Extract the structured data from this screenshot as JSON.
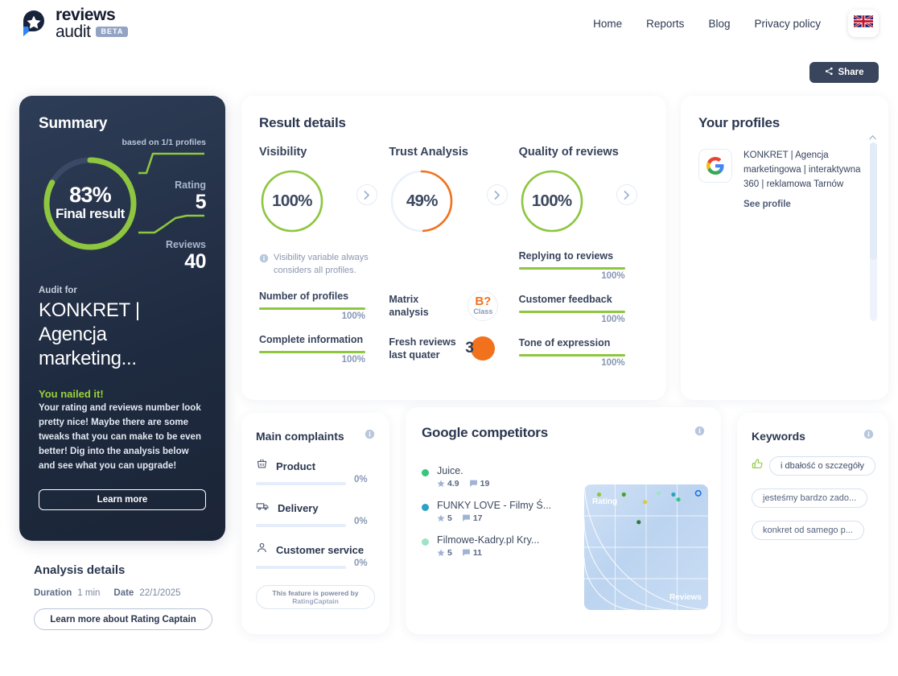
{
  "header": {
    "logo_line1": "reviews",
    "logo_line2": "audit",
    "beta": "BETA",
    "nav": [
      {
        "label": "Home"
      },
      {
        "label": "Reports"
      },
      {
        "label": "Blog"
      },
      {
        "label": "Privacy policy"
      }
    ],
    "flag_icon": "uk-flag-icon"
  },
  "share": {
    "label": "Share",
    "icon": "share-icon"
  },
  "summary": {
    "title": "Summary",
    "based_on": "based on 1/1 profiles",
    "final_percent": "83%",
    "final_label": "Final result",
    "final_value": 83,
    "rating_label": "Rating",
    "rating_value": "5",
    "reviews_label": "Reviews",
    "reviews_value": "40",
    "audit_for_label": "Audit for",
    "audit_name": "KONKRET | Agencja marketing...",
    "nailed_title": "You nailed it!",
    "nailed_body": "Your rating and reviews number look pretty nice! Maybe there are some tweaks that you can make to be even better! Dig into the analysis below and see what you can upgrade!",
    "learn_more": "Learn more",
    "accent_green": "#8ec63f"
  },
  "analysis": {
    "title": "Analysis details",
    "duration_label": "Duration",
    "duration_value": "1 min",
    "date_label": "Date",
    "date_value": "22/1/2025",
    "button": "Learn more about Rating Captain"
  },
  "result_details": {
    "title": "Result details",
    "gauges": [
      {
        "name": "Visibility",
        "value": "100%",
        "pct": 100,
        "color": "#8ec63f"
      },
      {
        "name": "Trust Analysis",
        "value": "49%",
        "pct": 49,
        "color": "#f2711c"
      },
      {
        "name": "Quality of reviews",
        "value": "100%",
        "pct": 100,
        "color": "#8ec63f"
      }
    ],
    "note": "Visibility variable always considers all profiles.",
    "left_metrics": [
      {
        "label": "Number of profiles",
        "value": "100%",
        "pct": 100
      },
      {
        "label": "Complete information",
        "value": "100%",
        "pct": 100
      }
    ],
    "right_metrics": [
      {
        "label": "Replying to reviews",
        "value": "100%",
        "pct": 100
      },
      {
        "label": "Customer feedback",
        "value": "100%",
        "pct": 100
      },
      {
        "label": "Tone of expression",
        "value": "100%",
        "pct": 100
      }
    ],
    "matrix_label": "Matrix analysis",
    "matrix_class_grade": "B?",
    "matrix_class_word": "Class",
    "fresh_label": "Fresh reviews last quater",
    "fresh_value": "3"
  },
  "profiles": {
    "title": "Your profiles",
    "items": [
      {
        "icon": "google-logo-icon",
        "name": "KONKRET | Agencja marketingowa | interaktywna 360 | reklamowa Tarnów",
        "link": "See profile"
      }
    ]
  },
  "complaints": {
    "title": "Main complaints",
    "info_icon": "info-icon",
    "items": [
      {
        "icon": "basket-icon",
        "label": "Product",
        "value": "0%",
        "pct": 0
      },
      {
        "icon": "truck-icon",
        "label": "Delivery",
        "value": "0%",
        "pct": 0
      },
      {
        "icon": "person-icon",
        "label": "Customer service",
        "value": "0%",
        "pct": 0
      }
    ],
    "powered_line1": "This feature is powered by",
    "powered_line2": "RatingCaptain"
  },
  "competitors": {
    "title": "Google competitors",
    "info_icon": "info-icon",
    "items": [
      {
        "name": "Juice.",
        "rating": "4.9",
        "reviews": "19",
        "color": "#34c77b"
      },
      {
        "name": "FUNKY LOVE - Filmy Ś...",
        "rating": "5",
        "reviews": "17",
        "color": "#2aa3c4"
      },
      {
        "name": "Filmowe-Kadry.pl Kry...",
        "rating": "5",
        "reviews": "11",
        "color": "#9fe3c5"
      }
    ],
    "chart_data": {
      "type": "scatter",
      "title": "",
      "xlabel": "Reviews",
      "ylabel": "Rating",
      "xlim": [
        0,
        100
      ],
      "ylim": [
        0,
        100
      ],
      "grid": true,
      "points": [
        {
          "x": 12,
          "y": 92,
          "color": "#8ec63f"
        },
        {
          "x": 32,
          "y": 92,
          "color": "#3fa62b"
        },
        {
          "x": 49,
          "y": 86,
          "color": "#e0c83a"
        },
        {
          "x": 44,
          "y": 70,
          "color": "#2f7a3a"
        },
        {
          "x": 60,
          "y": 93,
          "color": "#9fe3c5"
        },
        {
          "x": 72,
          "y": 92,
          "color": "#2aa3c4"
        },
        {
          "x": 76,
          "y": 88,
          "color": "#34c77b"
        },
        {
          "x": 92,
          "y": 93,
          "color": "#1a73e8",
          "hollow": true
        }
      ]
    }
  },
  "keywords": {
    "title": "Keywords",
    "info_icon": "info-icon",
    "items": [
      {
        "label": "i dbałość o szczegóły",
        "icon": "thumbs-up-icon"
      },
      {
        "label": "jesteśmy bardzo zado...",
        "icon": ""
      },
      {
        "label": "konkret od samego p...",
        "icon": ""
      }
    ]
  }
}
